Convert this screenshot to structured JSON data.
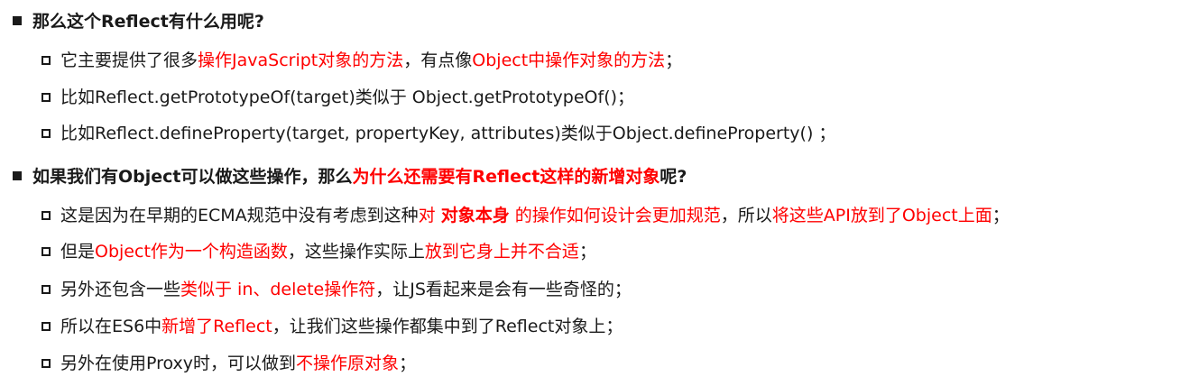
{
  "colors": {
    "text": "#1a1a1a",
    "highlight": "#ff0000",
    "background": "#ffffff"
  },
  "sections": [
    {
      "heading": {
        "bullet": "filled-square-bullet-icon",
        "segments": [
          {
            "text": "那么这个Reflect有什么用呢?",
            "red": false
          }
        ]
      },
      "items": [
        {
          "bullet": "hollow-square-bullet-icon",
          "segments": [
            {
              "text": "它主要提供了很多",
              "red": false
            },
            {
              "text": "操作JavaScript对象的方法",
              "red": true
            },
            {
              "text": "，有点像",
              "red": false
            },
            {
              "text": "Object中操作对象的方法",
              "red": true
            },
            {
              "text": "；",
              "red": false
            }
          ]
        },
        {
          "bullet": "hollow-square-bullet-icon",
          "segments": [
            {
              "text": "比如Reflect.getPrototypeOf(target)类似于 Object.getPrototypeOf()；",
              "red": false
            }
          ]
        },
        {
          "bullet": "hollow-square-bullet-icon",
          "segments": [
            {
              "text": "比如Reflect.defineProperty(target, propertyKey, attributes)类似于Object.defineProperty() ；",
              "red": false
            }
          ]
        }
      ]
    },
    {
      "heading": {
        "bullet": "filled-square-bullet-icon",
        "segments": [
          {
            "text": "如果我们有Object可以做这些操作，那么",
            "red": false
          },
          {
            "text": "为什么还需要有Reflect这样的新增对象",
            "red": true
          },
          {
            "text": "呢?",
            "red": false
          }
        ]
      },
      "items": [
        {
          "bullet": "hollow-square-bullet-icon",
          "segments": [
            {
              "text": "这是因为在早期的ECMA规范中没有考虑到这种",
              "red": false
            },
            {
              "text": "对 ",
              "red": true
            },
            {
              "text": "对象本身",
              "red": true,
              "bold": true
            },
            {
              "text": " 的操作如何设计会更加规范",
              "red": true
            },
            {
              "text": "，所以",
              "red": false
            },
            {
              "text": "将这些API放到了Object上面",
              "red": true
            },
            {
              "text": "；",
              "red": false
            }
          ]
        },
        {
          "bullet": "hollow-square-bullet-icon",
          "segments": [
            {
              "text": "但是",
              "red": false
            },
            {
              "text": "Object作为一个构造函数",
              "red": true
            },
            {
              "text": "，这些操作实际上",
              "red": false
            },
            {
              "text": "放到它身上并不合适",
              "red": true
            },
            {
              "text": "；",
              "red": false
            }
          ]
        },
        {
          "bullet": "hollow-square-bullet-icon",
          "segments": [
            {
              "text": "另外还包含一些",
              "red": false
            },
            {
              "text": "类似于 in、delete操作符",
              "red": true
            },
            {
              "text": "，让JS看起来是会有一些奇怪的；",
              "red": false
            }
          ]
        },
        {
          "bullet": "hollow-square-bullet-icon",
          "segments": [
            {
              "text": "所以在ES6中",
              "red": false
            },
            {
              "text": "新增了Reflect",
              "red": true
            },
            {
              "text": "，让我们这些操作都集中到了Reflect对象上；",
              "red": false
            }
          ]
        },
        {
          "bullet": "hollow-square-bullet-icon",
          "segments": [
            {
              "text": "另外在使用Proxy时，可以做到",
              "red": false
            },
            {
              "text": "不操作原对象",
              "red": true
            },
            {
              "text": "；",
              "red": false
            }
          ]
        }
      ]
    }
  ]
}
